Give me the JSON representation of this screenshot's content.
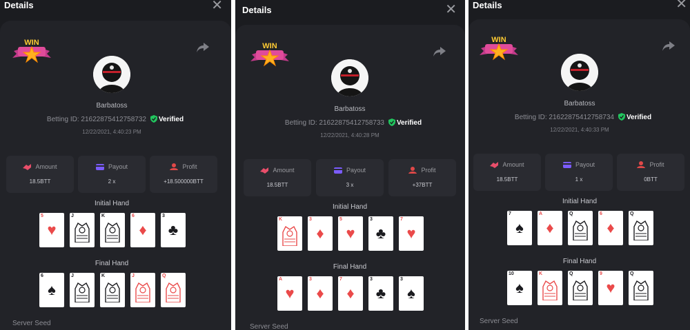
{
  "colors": {
    "panel_bg": "#1b1c20",
    "card_bg": "#222328",
    "stat_bg": "#2a2b31",
    "verified_green": "#22c55e",
    "amount_icon": "#e84e6a",
    "payout_icon": "#7b5cff",
    "profit_icon": "#e04848"
  },
  "panels": [
    {
      "title": "Details",
      "username": "Barbatoss",
      "betting_id_label": "Betting ID: 216228754127587​32",
      "verified_label": "Verified",
      "timestamp": "12/22/2021, 4:40:23 PM",
      "stats": [
        {
          "label": "Amount",
          "value": "18.5BTT",
          "icon": "amount-icon"
        },
        {
          "label": "Payout",
          "value": "2 x",
          "icon": "payout-icon"
        },
        {
          "label": "Profit",
          "value": "+18.500000BTT",
          "icon": "profit-icon"
        }
      ],
      "initial_hand_label": "Initial Hand",
      "final_hand_label": "Final Hand",
      "initial_hand": [
        {
          "rank": "5",
          "suit": "♥",
          "color": "red",
          "face": false
        },
        {
          "rank": "J",
          "suit": "♣",
          "color": "black",
          "face": true
        },
        {
          "rank": "K",
          "suit": "♠",
          "color": "black",
          "face": true
        },
        {
          "rank": "6",
          "suit": "♦",
          "color": "red",
          "face": false
        },
        {
          "rank": "3",
          "suit": "♣",
          "color": "black",
          "face": false
        }
      ],
      "final_hand": [
        {
          "rank": "6",
          "suit": "♠",
          "color": "black",
          "face": false
        },
        {
          "rank": "J",
          "suit": "♣",
          "color": "black",
          "face": true
        },
        {
          "rank": "K",
          "suit": "♠",
          "color": "black",
          "face": true
        },
        {
          "rank": "J",
          "suit": "♥",
          "color": "red",
          "face": true
        },
        {
          "rank": "Q",
          "suit": "♦",
          "color": "red",
          "face": true
        }
      ],
      "server_seed_label": "Server Seed"
    },
    {
      "title": "Details",
      "username": "Barbatoss",
      "betting_id_label": "Betting ID: 216228754127587​33",
      "verified_label": "Verified",
      "timestamp": "12/22/2021, 4:40:28 PM",
      "stats": [
        {
          "label": "Amount",
          "value": "18.5BTT",
          "icon": "amount-icon"
        },
        {
          "label": "Payout",
          "value": "3 x",
          "icon": "payout-icon"
        },
        {
          "label": "Profit",
          "value": "+37BTT",
          "icon": "profit-icon"
        }
      ],
      "initial_hand_label": "Initial Hand",
      "final_hand_label": "Final Hand",
      "initial_hand": [
        {
          "rank": "K",
          "suit": "♦",
          "color": "red",
          "face": true
        },
        {
          "rank": "3",
          "suit": "♦",
          "color": "red",
          "face": false
        },
        {
          "rank": "5",
          "suit": "♥",
          "color": "red",
          "face": false
        },
        {
          "rank": "3",
          "suit": "♣",
          "color": "black",
          "face": false
        },
        {
          "rank": "7",
          "suit": "♥",
          "color": "red",
          "face": false
        }
      ],
      "final_hand": [
        {
          "rank": "A",
          "suit": "♥",
          "color": "red",
          "face": false
        },
        {
          "rank": "3",
          "suit": "♦",
          "color": "red",
          "face": false
        },
        {
          "rank": "7",
          "suit": "♦",
          "color": "red",
          "face": false
        },
        {
          "rank": "3",
          "suit": "♣",
          "color": "black",
          "face": false
        },
        {
          "rank": "3",
          "suit": "♠",
          "color": "black",
          "face": false
        }
      ],
      "server_seed_label": "Server Seed"
    },
    {
      "title": "Details",
      "username": "Barbatoss",
      "betting_id_label": "Betting ID: 216228754127587​34",
      "verified_label": "Verified",
      "timestamp": "12/22/2021, 4:40:33 PM",
      "stats": [
        {
          "label": "Amount",
          "value": "18.5BTT",
          "icon": "amount-icon"
        },
        {
          "label": "Payout",
          "value": "1 x",
          "icon": "payout-icon"
        },
        {
          "label": "Profit",
          "value": "0BTT",
          "icon": "profit-icon"
        }
      ],
      "initial_hand_label": "Initial Hand",
      "final_hand_label": "Final Hand",
      "initial_hand": [
        {
          "rank": "7",
          "suit": "♠",
          "color": "black",
          "face": false
        },
        {
          "rank": "A",
          "suit": "♦",
          "color": "red",
          "face": false
        },
        {
          "rank": "Q",
          "suit": "♣",
          "color": "black",
          "face": true
        },
        {
          "rank": "6",
          "suit": "♦",
          "color": "red",
          "face": false
        },
        {
          "rank": "Q",
          "suit": "♠",
          "color": "black",
          "face": true
        }
      ],
      "final_hand": [
        {
          "rank": "10",
          "suit": "♠",
          "color": "black",
          "face": false
        },
        {
          "rank": "K",
          "suit": "♦",
          "color": "red",
          "face": true
        },
        {
          "rank": "Q",
          "suit": "♣",
          "color": "black",
          "face": true
        },
        {
          "rank": "9",
          "suit": "♥",
          "color": "red",
          "face": false
        },
        {
          "rank": "Q",
          "suit": "♠",
          "color": "black",
          "face": true
        }
      ],
      "server_seed_label": "Server Seed"
    }
  ]
}
